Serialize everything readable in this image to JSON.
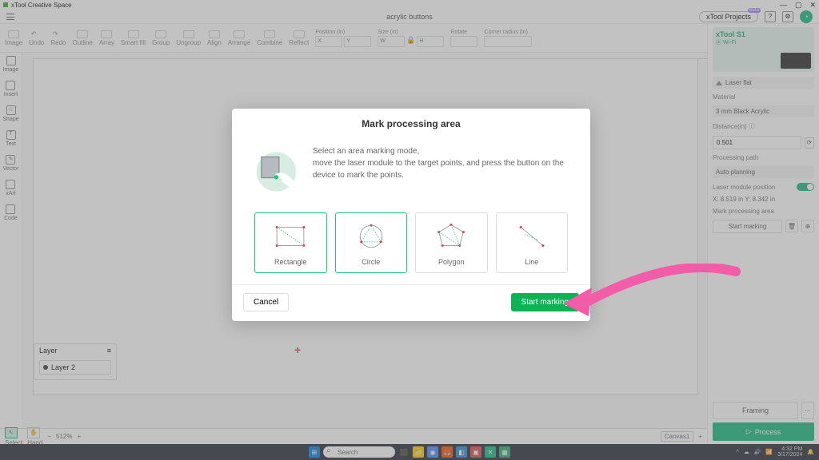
{
  "titlebar": {
    "app": "xTool Creative Space"
  },
  "window_controls": {
    "min": "—",
    "max": "▢",
    "close": "✕"
  },
  "header": {
    "filename": "acrylic buttons",
    "projects_btn": "xTool Projects",
    "projects_badge": "Beta"
  },
  "toolbar": {
    "items": [
      "Image",
      "Undo",
      "Redo",
      "Outline",
      "Array",
      "Smart fill",
      "Group",
      "Ungroup",
      "Align",
      "Arrange",
      "Combine",
      "Reflect"
    ],
    "position_label": "Position (in)",
    "position": {
      "x": "X",
      "y": "Y"
    },
    "size_label": "Size (in)",
    "size": {
      "w": "W",
      "h": "H"
    },
    "rotate_label": "Rotate",
    "corner_label": "Corner radius (in)"
  },
  "left_tools": [
    "Image",
    "Insert",
    "Shape",
    "Text",
    "Vector",
    "xArt",
    "Code"
  ],
  "layers": {
    "title": "Layer",
    "item": "Layer 2"
  },
  "bottom": {
    "zoom": "512%",
    "select": "Select",
    "hand": "Hand",
    "canvas_tab": "Canvas1"
  },
  "right": {
    "device": "xTool S1",
    "conn": "⦿ Wi-Fi",
    "laser_head": "Laser flat",
    "material_label": "Material",
    "material_value": "3 mm Black Acrylic",
    "distance_label": "Distance(in) ⓘ",
    "distance_value": "0.501",
    "path_label": "Processing path",
    "path_value": "Auto planning",
    "lmp_label": "Laser module position",
    "coords": "X: 8.519 in   Y: 8.342 in",
    "mark_label": "Mark processing area",
    "mark_btn": "Start marking",
    "framing": "Framing",
    "process": "Process"
  },
  "modal": {
    "title": "Mark processing area",
    "desc1": "Select an area marking mode,",
    "desc2": "move the laser module to the target points, and press the button on the device to mark the points.",
    "shapes": [
      "Rectangle",
      "Circle",
      "Polygon",
      "Line"
    ],
    "cancel": "Cancel",
    "start": "Start marking"
  },
  "taskbar": {
    "search": "Search",
    "time": "4:32 PM",
    "date": "3/17/2024"
  }
}
